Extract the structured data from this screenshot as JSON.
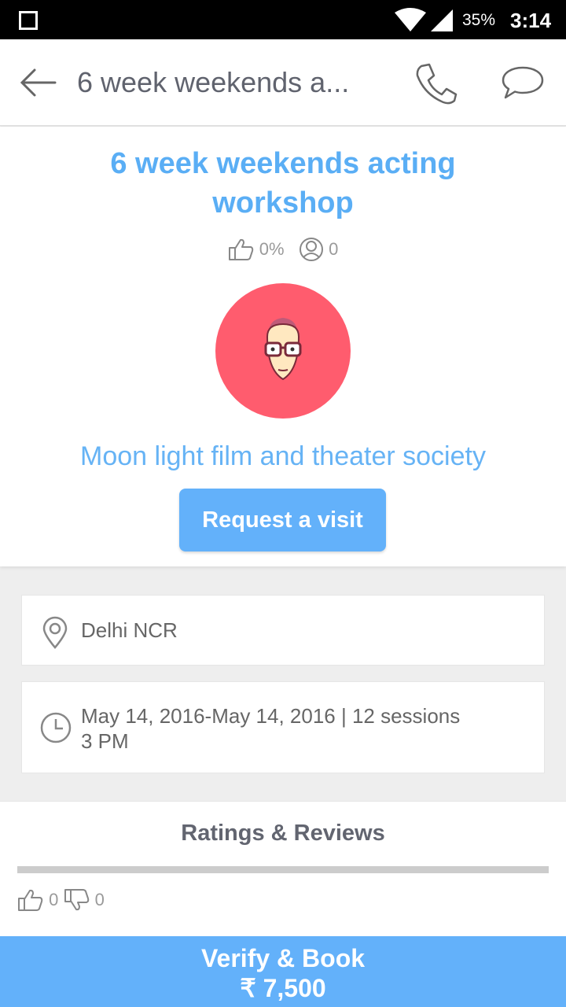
{
  "status_bar": {
    "battery": "35%",
    "time": "3:14"
  },
  "toolbar": {
    "title": "6 week weekends a..."
  },
  "course": {
    "title": "6 week weekends acting workshop",
    "like_percent": "0%",
    "followers": "0",
    "organizer": "Moon light film and theater society",
    "request_label": "Request a visit"
  },
  "location": {
    "text": "Delhi NCR"
  },
  "schedule": {
    "dates": "May 14, 2016-May 14, 2016 | 12 sessions",
    "time": "3 PM"
  },
  "ratings": {
    "title": "Ratings & Reviews",
    "likes": "0",
    "dislikes": "0"
  },
  "book": {
    "label": "Verify & Book",
    "price": "₹ 7,500"
  },
  "colors": {
    "accent": "#63b1fa",
    "title": "#5aaef5",
    "avatar_bg": "#ff5c6e"
  }
}
